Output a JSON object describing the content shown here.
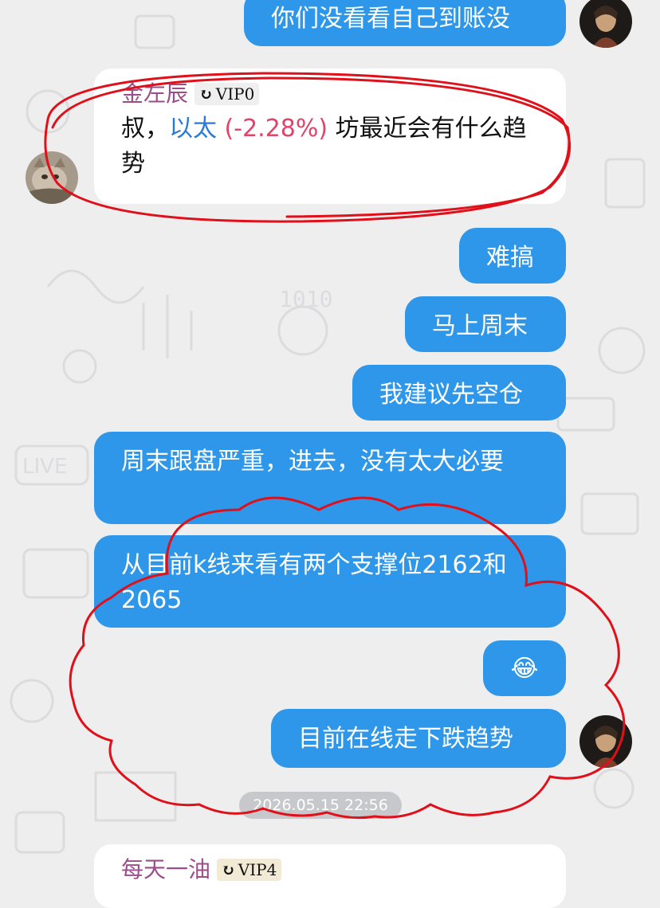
{
  "chat": {
    "top_message": "你们没看看自己到账没",
    "incoming_1": {
      "sender": "金左辰",
      "vip": "VIP0",
      "text_before": "叔，",
      "ticker": "以太",
      "change": "(-2.28%)",
      "text_after": "坊最近会有什么趋势"
    },
    "outgoing": [
      "难搞",
      "马上周末",
      "我建议先空仓",
      "周末跟盘严重，进去，没有太大必要",
      "从目前k线来看有两个支撑位2162和2065",
      "😂",
      "目前在线走下跌趋势"
    ],
    "timestamp": "2026.05.15 22:56",
    "incoming_2": {
      "sender": "每天一油",
      "vip": "VIP4"
    }
  },
  "icons": {
    "vip_icon": "vip-swirl-icon",
    "avatar_user": "avatar-cat",
    "avatar_self": "avatar-character"
  },
  "colors": {
    "outgoing_bubble": "#2f97e9",
    "incoming_bubble": "#ffffff",
    "sender_name": "#9b4d8a",
    "ticker": "#2b7bd6",
    "ticker_change": "#e0446a",
    "annotation": "#e0101a"
  }
}
